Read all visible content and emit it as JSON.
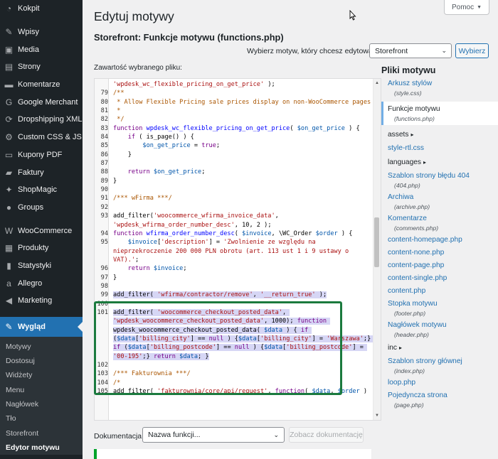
{
  "sidebar": {
    "items": [
      {
        "label": "Kokpit",
        "icon": "dashboard-icon"
      },
      {
        "sep": true
      },
      {
        "label": "Wpisy",
        "icon": "pin-icon"
      },
      {
        "label": "Media",
        "icon": "media-icon"
      },
      {
        "label": "Strony",
        "icon": "pages-icon"
      },
      {
        "label": "Komentarze",
        "icon": "comments-icon"
      },
      {
        "label": "Google Merchant",
        "icon": "google-icon"
      },
      {
        "label": "Dropshipping XML",
        "icon": "sync-icon"
      },
      {
        "label": "Custom CSS & JS",
        "icon": "gear-icon"
      },
      {
        "label": "Kupony PDF",
        "icon": "ticket-icon"
      },
      {
        "label": "Faktury",
        "icon": "folder-icon"
      },
      {
        "label": "ShopMagic",
        "icon": "magic-icon"
      },
      {
        "label": "Groups",
        "icon": "groups-icon"
      },
      {
        "sep": true
      },
      {
        "label": "WooCommerce",
        "icon": "woo-icon"
      },
      {
        "label": "Produkty",
        "icon": "box-icon"
      },
      {
        "label": "Statystyki",
        "icon": "chart-icon"
      },
      {
        "label": "Allegro",
        "icon": "allegro-icon"
      },
      {
        "label": "Marketing",
        "icon": "megaphone-icon"
      },
      {
        "sep": true
      },
      {
        "label": "Wygląd",
        "icon": "brush-icon",
        "active": true
      }
    ],
    "submenu": [
      {
        "label": "Motywy"
      },
      {
        "label": "Dostosuj"
      },
      {
        "label": "Widżety"
      },
      {
        "label": "Menu"
      },
      {
        "label": "Nagłówek"
      },
      {
        "label": "Tło"
      },
      {
        "label": "Storefront"
      },
      {
        "label": "Edytor motywu",
        "current": true
      }
    ]
  },
  "header": {
    "title": "Edytuj motywy",
    "file_title": "Storefront: Funkcje motywu (functions.php)",
    "help_label": "Pomoc",
    "select_label": "Wybierz motyw, który chcesz edytować:",
    "select_value": "Storefront",
    "choose_button": "Wybierz"
  },
  "editor": {
    "label": "Zawartość wybranego pliku:",
    "lines": [
      {
        "n": "",
        "parts": [
          {
            "t": "'wpdesk_wc_flexible_pricing_on_get_price'",
            "c": "str"
          },
          {
            "t": " );",
            "c": "plain"
          }
        ]
      },
      {
        "n": "79",
        "parts": [
          {
            "t": "/**",
            "c": "com"
          }
        ]
      },
      {
        "n": "80",
        "parts": [
          {
            "t": " * Allow Flexible Pricing sale prices display on non-WooCommerce pages",
            "c": "com"
          }
        ]
      },
      {
        "n": "81",
        "parts": [
          {
            "t": " *",
            "c": "com"
          }
        ]
      },
      {
        "n": "82",
        "parts": [
          {
            "t": " */",
            "c": "com"
          }
        ]
      },
      {
        "n": "83",
        "parts": [
          {
            "t": "function ",
            "c": "kw"
          },
          {
            "t": "wpdesk_wc_flexible_pricing_on_get_price",
            "c": "def"
          },
          {
            "t": "( ",
            "c": "plain"
          },
          {
            "t": "$on_get_price",
            "c": "var"
          },
          {
            "t": " ) {",
            "c": "plain"
          }
        ]
      },
      {
        "n": "84",
        "parts": [
          {
            "t": "    if",
            "c": "kw"
          },
          {
            "t": " ( is_page() ) {",
            "c": "plain"
          }
        ]
      },
      {
        "n": "85",
        "parts": [
          {
            "t": "        $on_get_price",
            "c": "var"
          },
          {
            "t": " = ",
            "c": "plain"
          },
          {
            "t": "true",
            "c": "kw"
          },
          {
            "t": ";",
            "c": "plain"
          }
        ]
      },
      {
        "n": "86",
        "parts": [
          {
            "t": "    }",
            "c": "plain"
          }
        ]
      },
      {
        "n": "87",
        "parts": [
          {
            "t": "",
            "c": "plain"
          }
        ]
      },
      {
        "n": "88",
        "parts": [
          {
            "t": "    return ",
            "c": "kw"
          },
          {
            "t": "$on_get_price",
            "c": "var"
          },
          {
            "t": ";",
            "c": "plain"
          }
        ]
      },
      {
        "n": "89",
        "parts": [
          {
            "t": "}",
            "c": "plain"
          }
        ]
      },
      {
        "n": "90",
        "parts": [
          {
            "t": "",
            "c": "plain"
          }
        ]
      },
      {
        "n": "91",
        "parts": [
          {
            "t": "/*** wFirma ***/",
            "c": "com"
          }
        ]
      },
      {
        "n": "92",
        "parts": [
          {
            "t": "",
            "c": "plain"
          }
        ]
      },
      {
        "n": "93",
        "parts": [
          {
            "t": "add_filter(",
            "c": "plain"
          },
          {
            "t": "'woocommerce_wfirma_invoice_data'",
            "c": "str"
          },
          {
            "t": ", ",
            "c": "plain"
          },
          {
            "t": "'wpdesk_wfirma_order_number_desc'",
            "c": "str"
          },
          {
            "t": ", 10, 2 );",
            "c": "plain"
          }
        ]
      },
      {
        "n": "94",
        "parts": [
          {
            "t": "function ",
            "c": "kw"
          },
          {
            "t": "wfirma_order_number_desc",
            "c": "def"
          },
          {
            "t": "( ",
            "c": "plain"
          },
          {
            "t": "$invoice",
            "c": "var"
          },
          {
            "t": ", \\WC_Order ",
            "c": "plain"
          },
          {
            "t": "$order",
            "c": "var"
          },
          {
            "t": " ) {",
            "c": "plain"
          }
        ]
      },
      {
        "n": "95",
        "parts": [
          {
            "t": "    $invoice",
            "c": "var"
          },
          {
            "t": "[",
            "c": "plain"
          },
          {
            "t": "'description'",
            "c": "str"
          },
          {
            "t": "] = ",
            "c": "plain"
          },
          {
            "t": "'Zwolnienie ze względu na nieprzekroczenie 200 000 PLN obrotu (art. 113 ust 1 i 9 ustawy o VAT).'",
            "c": "str"
          },
          {
            "t": ";",
            "c": "plain"
          }
        ]
      },
      {
        "n": "96",
        "parts": [
          {
            "t": "    return ",
            "c": "kw"
          },
          {
            "t": "$invoice",
            "c": "var"
          },
          {
            "t": ";",
            "c": "plain"
          }
        ]
      },
      {
        "n": "97",
        "parts": [
          {
            "t": "}",
            "c": "plain"
          }
        ]
      },
      {
        "n": "98",
        "parts": [
          {
            "t": "",
            "c": "plain"
          }
        ]
      },
      {
        "n": "99",
        "sel": true,
        "parts": [
          {
            "t": "add_filter( ",
            "c": "plain"
          },
          {
            "t": "'wfirma/contractor/remove'",
            "c": "str"
          },
          {
            "t": ", ",
            "c": "plain"
          },
          {
            "t": "'__return_true'",
            "c": "str"
          },
          {
            "t": " );",
            "c": "plain"
          }
        ]
      },
      {
        "n": "100",
        "parts": [
          {
            "t": "",
            "c": "plain"
          }
        ]
      },
      {
        "n": "101",
        "sel": true,
        "parts": [
          {
            "t": "add_filter( ",
            "c": "plain"
          },
          {
            "t": "'woocommerce_checkout_posted_data'",
            "c": "str"
          },
          {
            "t": ", ",
            "c": "plain"
          },
          {
            "t": "'wpdesk_woocommerce_checkout_posted_data'",
            "c": "str"
          },
          {
            "t": ", 1000); ",
            "c": "plain"
          },
          {
            "t": "function ",
            "c": "kw"
          },
          {
            "t": "wpdesk_woocommerce_checkout_posted_data( ",
            "c": "plain"
          },
          {
            "t": "$data",
            "c": "var"
          },
          {
            "t": " ) { ",
            "c": "plain"
          },
          {
            "t": "if",
            "c": "kw"
          },
          {
            "t": " (",
            "c": "plain"
          },
          {
            "t": "$data",
            "c": "var"
          },
          {
            "t": "[",
            "c": "plain"
          },
          {
            "t": "'billing_city'",
            "c": "str"
          },
          {
            "t": "] == ",
            "c": "plain"
          },
          {
            "t": "null",
            "c": "kw"
          },
          {
            "t": " ) {",
            "c": "plain"
          },
          {
            "t": "$data",
            "c": "var"
          },
          {
            "t": "[",
            "c": "plain"
          },
          {
            "t": "'billing_city'",
            "c": "str"
          },
          {
            "t": "] = ",
            "c": "plain"
          },
          {
            "t": "'Warszawa'",
            "c": "str"
          },
          {
            "t": ";} ",
            "c": "plain"
          },
          {
            "t": "if",
            "c": "kw"
          },
          {
            "t": " (",
            "c": "plain"
          },
          {
            "t": "$data",
            "c": "var"
          },
          {
            "t": "[",
            "c": "plain"
          },
          {
            "t": "'billing_postcode'",
            "c": "str"
          },
          {
            "t": "] == ",
            "c": "plain"
          },
          {
            "t": "null",
            "c": "kw"
          },
          {
            "t": " ) {",
            "c": "plain"
          },
          {
            "t": "$data",
            "c": "var"
          },
          {
            "t": "[",
            "c": "plain"
          },
          {
            "t": "'billing_postcode'",
            "c": "str"
          },
          {
            "t": "] = ",
            "c": "plain"
          },
          {
            "t": "'00-195'",
            "c": "str"
          },
          {
            "t": ";} ",
            "c": "plain"
          },
          {
            "t": "return ",
            "c": "kw"
          },
          {
            "t": "$data",
            "c": "var"
          },
          {
            "t": "; }",
            "c": "plain"
          }
        ]
      },
      {
        "n": "102",
        "parts": [
          {
            "t": "",
            "c": "plain"
          }
        ]
      },
      {
        "n": "103",
        "parts": [
          {
            "t": "/*** Fakturownia ***/",
            "c": "com"
          }
        ]
      },
      {
        "n": "104",
        "parts": [
          {
            "t": "/*",
            "c": "com"
          }
        ]
      },
      {
        "n": "105",
        "parts": [
          {
            "t": "add_filter( ",
            "c": "plain"
          },
          {
            "t": "'fakturownia/core/api/request'",
            "c": "str"
          },
          {
            "t": ", ",
            "c": "plain"
          },
          {
            "t": "function",
            "c": "kw"
          },
          {
            "t": "( ",
            "c": "plain"
          },
          {
            "t": "$data",
            "c": "var"
          },
          {
            "t": ", ",
            "c": "plain"
          },
          {
            "t": "$order",
            "c": "var"
          },
          {
            "t": " )",
            "c": "plain"
          }
        ]
      }
    ]
  },
  "files": {
    "heading": "Pliki motywu",
    "items": [
      {
        "type": "file",
        "name": "Arkusz stylów",
        "sub": "(style.css)"
      },
      {
        "type": "file",
        "name": "Funkcje motywu",
        "sub": "(functions.php)",
        "current": true
      },
      {
        "type": "folder",
        "name": "assets"
      },
      {
        "type": "file",
        "name": "style-rtl.css"
      },
      {
        "type": "folder",
        "name": "languages"
      },
      {
        "type": "file",
        "name": "Szablon strony błędu 404",
        "sub": "(404.php)"
      },
      {
        "type": "file",
        "name": "Archiwa",
        "sub": "(archive.php)"
      },
      {
        "type": "file",
        "name": "Komentarze",
        "sub": "(comments.php)"
      },
      {
        "type": "file",
        "name": "content-homepage.php"
      },
      {
        "type": "file",
        "name": "content-none.php"
      },
      {
        "type": "file",
        "name": "content-page.php"
      },
      {
        "type": "file",
        "name": "content-single.php"
      },
      {
        "type": "file",
        "name": "content.php"
      },
      {
        "type": "file",
        "name": "Stopka motywu",
        "sub": "(footer.php)"
      },
      {
        "type": "file",
        "name": "Nagłówek motywu",
        "sub": "(header.php)"
      },
      {
        "type": "folder",
        "name": "inc"
      },
      {
        "type": "file",
        "name": "Szablon strony głównej",
        "sub": "(index.php)"
      },
      {
        "type": "file",
        "name": "loop.php"
      },
      {
        "type": "file",
        "name": "Pojedyncza strona",
        "sub": "(page.php)"
      }
    ]
  },
  "docs": {
    "label": "Dokumentacja:",
    "select_value": "Nazwa funkcji...",
    "button": "Zobacz dokumentację"
  },
  "colors": {
    "sidebar_bg": "#1d2327",
    "accent": "#2271b1",
    "highlight_border": "#1b7a3e"
  }
}
